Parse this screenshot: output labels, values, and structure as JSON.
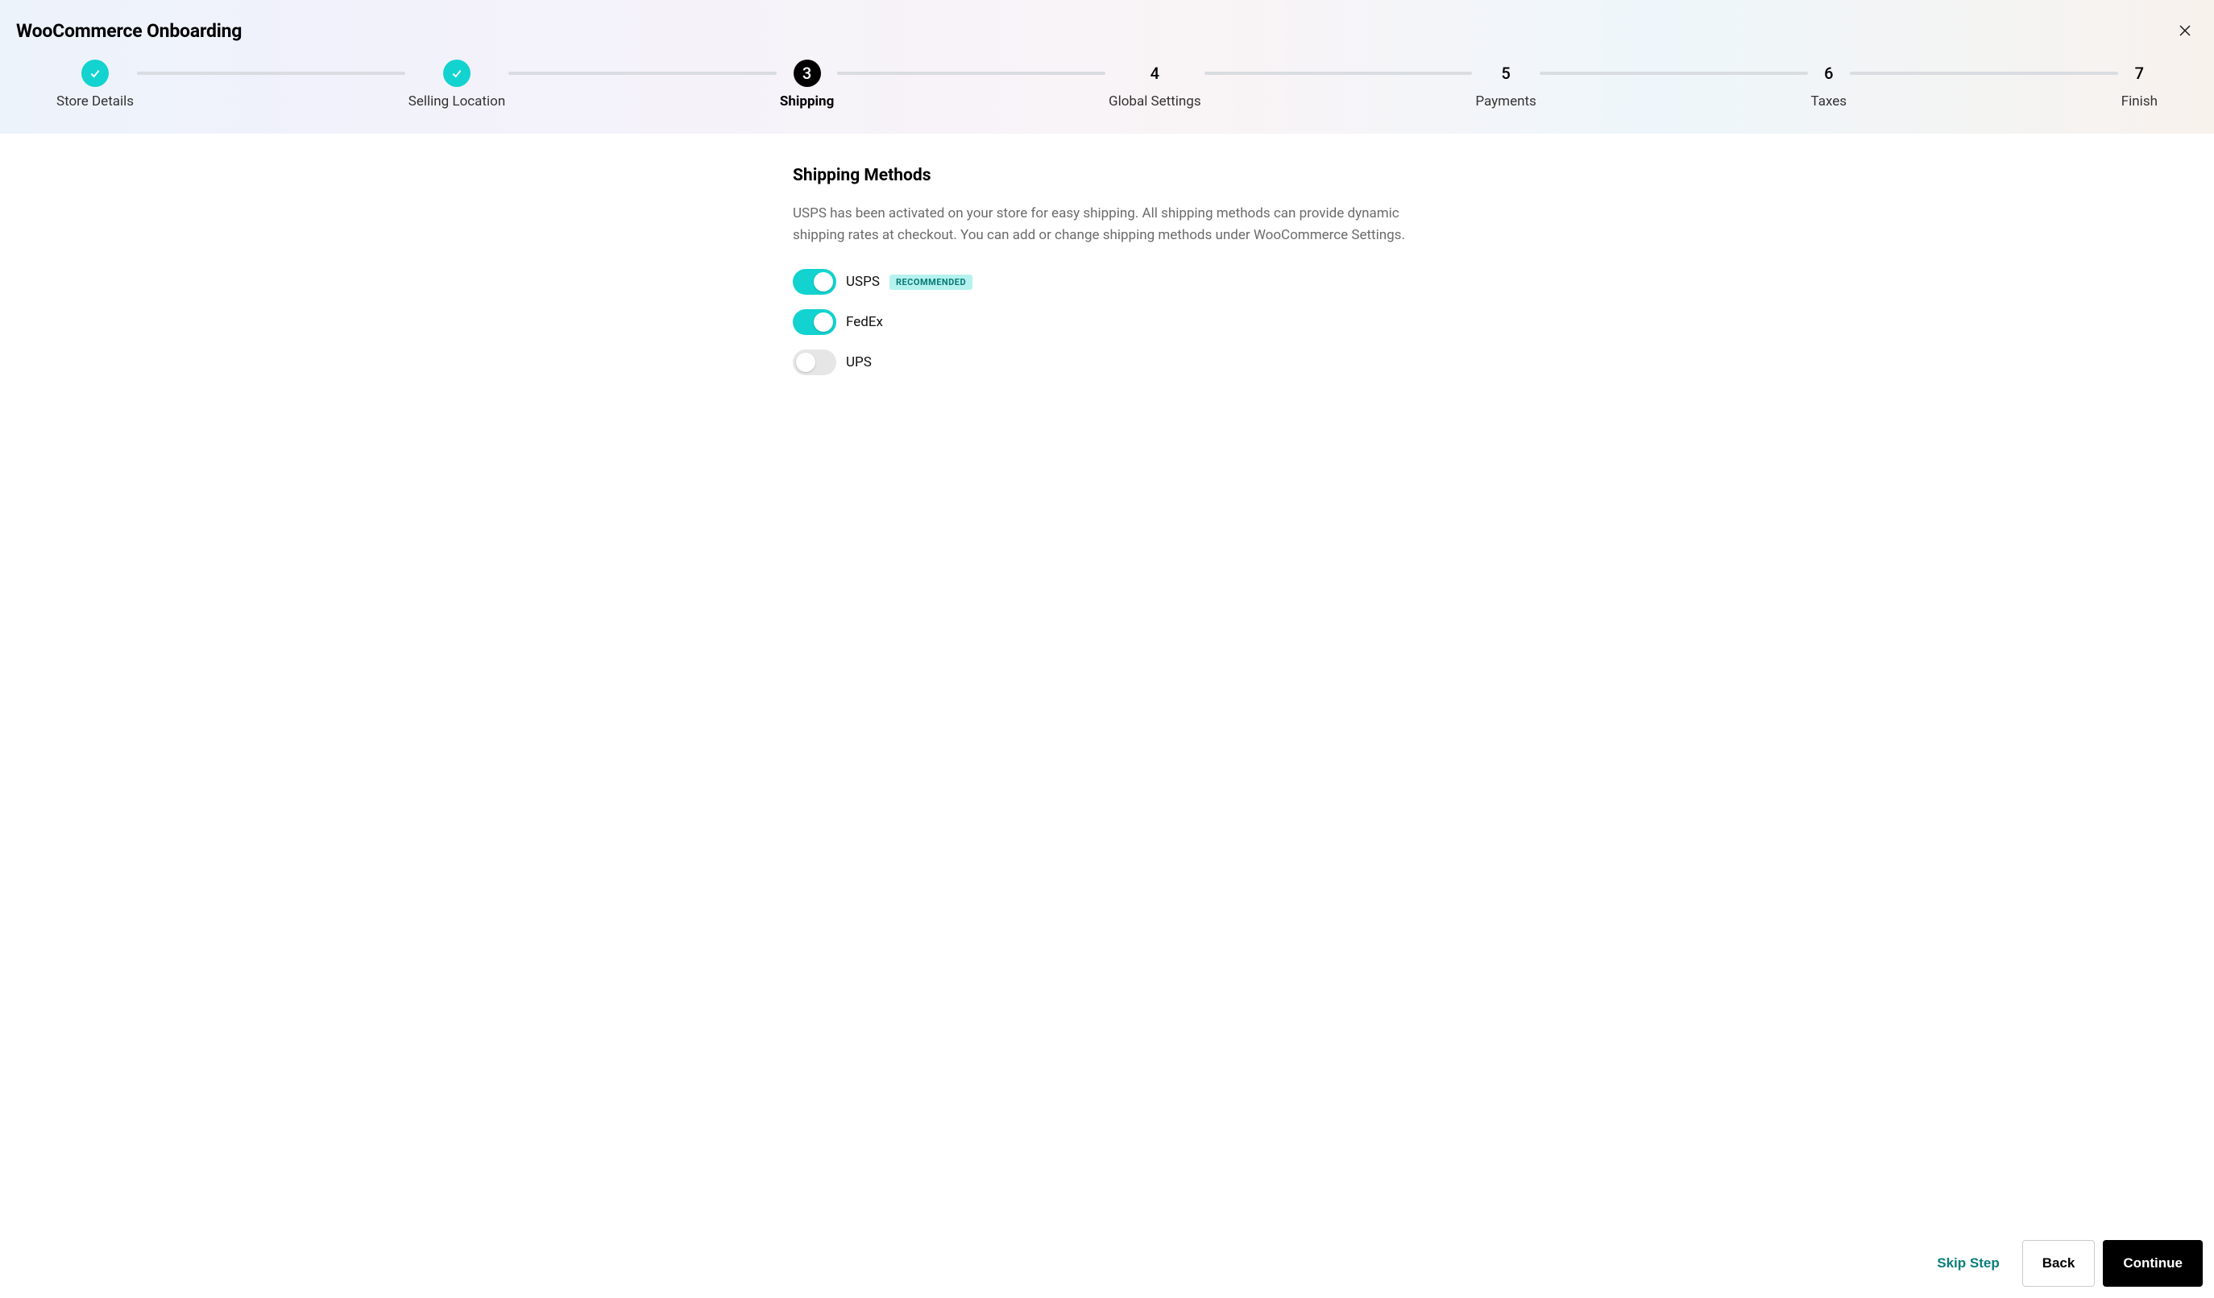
{
  "header": {
    "title": "WooCommerce Onboarding"
  },
  "stepper": {
    "steps": [
      {
        "label": "Store Details",
        "state": "done",
        "display": ""
      },
      {
        "label": "Selling Location",
        "state": "done",
        "display": ""
      },
      {
        "label": "Shipping",
        "state": "current",
        "display": "3"
      },
      {
        "label": "Global Settings",
        "state": "pending",
        "display": "4"
      },
      {
        "label": "Payments",
        "state": "pending",
        "display": "5"
      },
      {
        "label": "Taxes",
        "state": "pending",
        "display": "6"
      },
      {
        "label": "Finish",
        "state": "pending",
        "display": "7"
      }
    ]
  },
  "section": {
    "title": "Shipping Methods",
    "description": "USPS has been activated on your store for easy shipping. All shipping methods can provide dynamic shipping rates at checkout. You can add or change shipping methods under WooCommerce Settings."
  },
  "methods": [
    {
      "name": "USPS",
      "enabled": true,
      "recommended": true
    },
    {
      "name": "FedEx",
      "enabled": true,
      "recommended": false
    },
    {
      "name": "UPS",
      "enabled": false,
      "recommended": false
    }
  ],
  "badge": {
    "recommended": "RECOMMENDED"
  },
  "footer": {
    "skip": "Skip Step",
    "back": "Back",
    "continue": "Continue"
  }
}
